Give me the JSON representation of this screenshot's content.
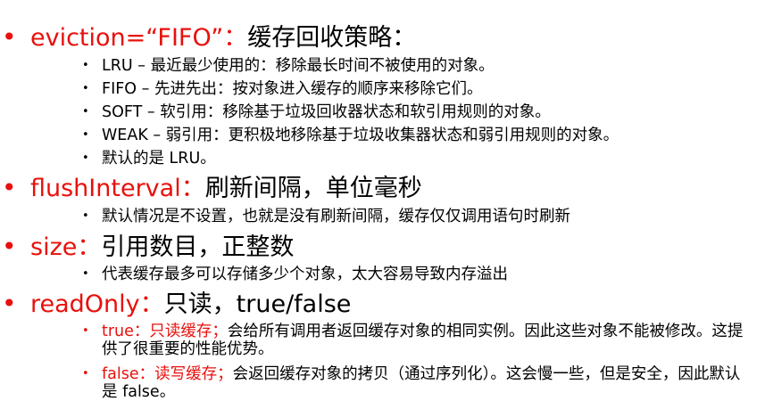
{
  "sections": {
    "eviction": {
      "bullet": "•",
      "key": "eviction=“FIFO”：",
      "desc": "缓存回收策略：",
      "items": [
        "LRU – 最近最少使用的：移除最长时间不被使用的对象。",
        "FIFO – 先进先出：按对象进入缓存的顺序来移除它们。",
        "SOFT – 软引用：移除基于垃圾回收器状态和软引用规则的对象。",
        "WEAK – 弱引用：更积极地移除基于垃圾收集器状态和弱引用规则的对象。",
        "默认的是 LRU。"
      ]
    },
    "flushInterval": {
      "bullet": "•",
      "key": "flushInterval：",
      "desc": "刷新间隔，单位毫秒",
      "items": [
        "默认情况是不设置，也就是没有刷新间隔，缓存仅仅调用语句时刷新"
      ]
    },
    "size": {
      "bullet": "•",
      "key": "size：",
      "desc": "引用数目，正整数",
      "items": [
        "代表缓存最多可以存储多少个对象，太大容易导致内存溢出"
      ]
    },
    "readOnly": {
      "bullet": "•",
      "key": "readOnly：",
      "desc": "只读，true/false",
      "items": [
        {
          "label": "true：只读缓存；",
          "text": "会给所有调用者返回缓存对象的相同实例。因此这些对象不能被修改。这提供了很重要的性能优势。"
        },
        {
          "label": "false：读写缓存；",
          "text": "会返回缓存对象的拷贝（通过序列化）。这会慢一些，但是安全，因此默认是 false。"
        }
      ]
    }
  },
  "sub_bullet": "•",
  "colors": {
    "accent_red": "#e8100c",
    "text": "#000000",
    "background": "#ffffff"
  }
}
